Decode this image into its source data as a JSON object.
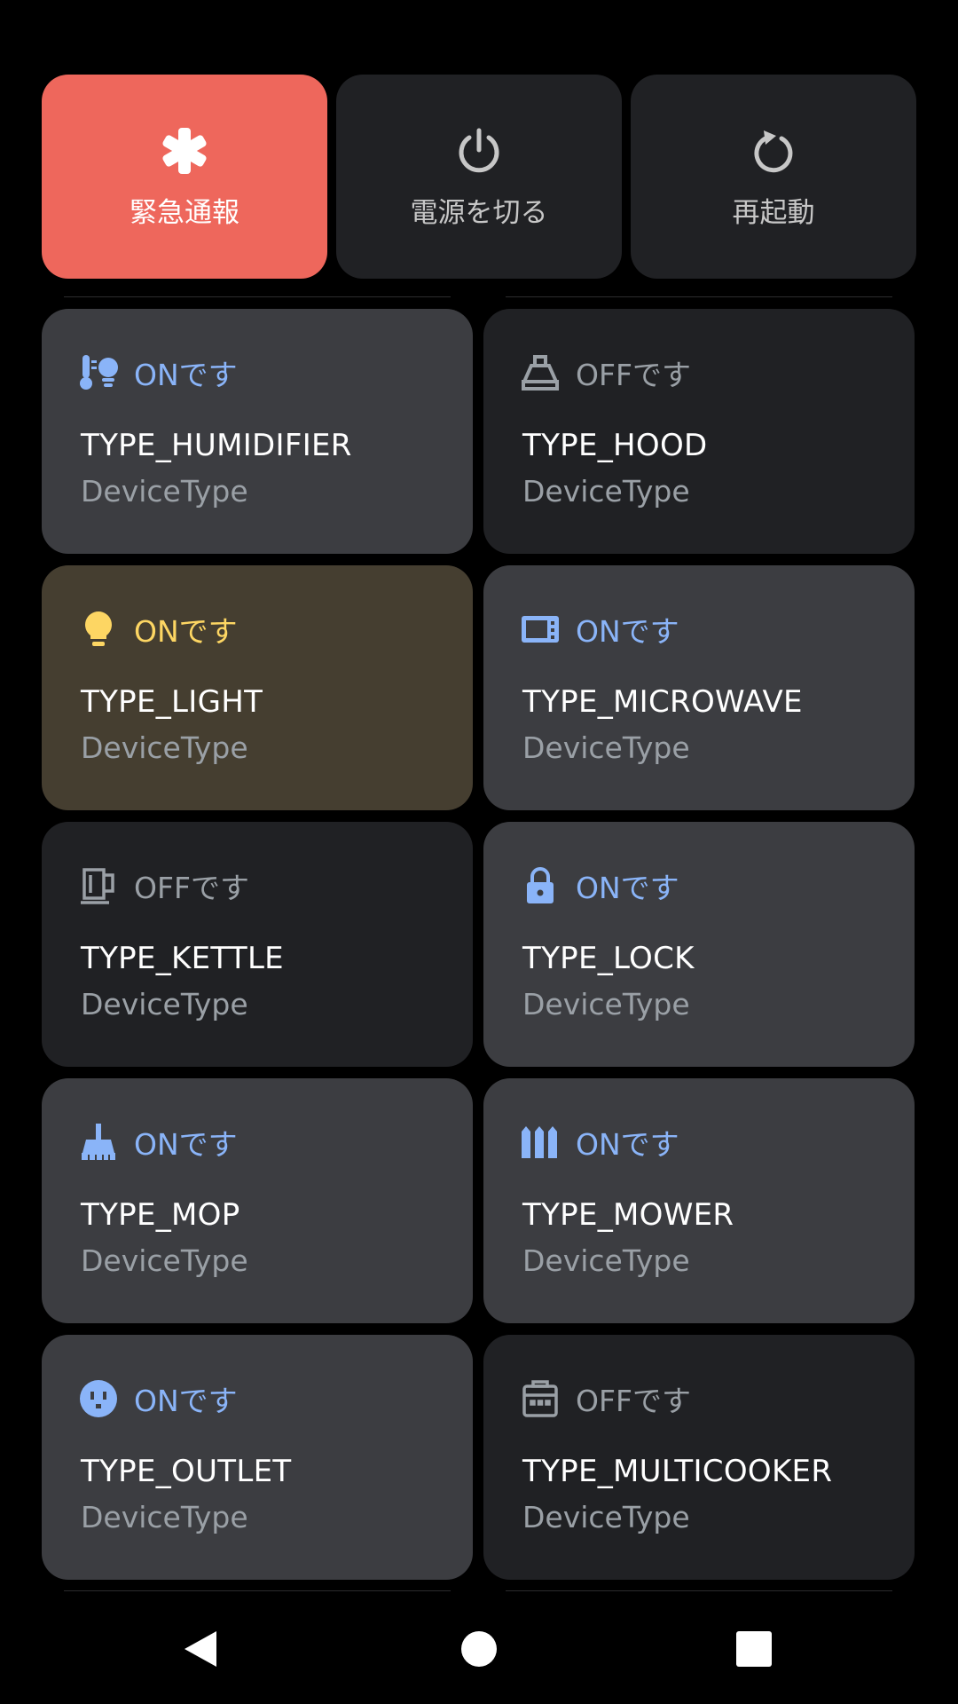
{
  "power_menu": {
    "emergency_label": "緊急通報",
    "power_off_label": "電源を切る",
    "restart_label": "再起動"
  },
  "tiles": [
    {
      "status": "ONです",
      "name": "TYPE_HUMIDIFIER",
      "subtitle": "DeviceType",
      "icon": "humidifier-icon"
    },
    {
      "status": "OFFです",
      "name": "TYPE_HOOD",
      "subtitle": "DeviceType",
      "icon": "hood-icon"
    },
    {
      "status": "ONです",
      "name": "TYPE_LIGHT",
      "subtitle": "DeviceType",
      "icon": "lightbulb-icon"
    },
    {
      "status": "ONです",
      "name": "TYPE_MICROWAVE",
      "subtitle": "DeviceType",
      "icon": "microwave-icon"
    },
    {
      "status": "OFFです",
      "name": "TYPE_KETTLE",
      "subtitle": "DeviceType",
      "icon": "kettle-icon"
    },
    {
      "status": "ONです",
      "name": "TYPE_LOCK",
      "subtitle": "DeviceType",
      "icon": "lock-icon"
    },
    {
      "status": "ONです",
      "name": "TYPE_MOP",
      "subtitle": "DeviceType",
      "icon": "mop-icon"
    },
    {
      "status": "ONです",
      "name": "TYPE_MOWER",
      "subtitle": "DeviceType",
      "icon": "mower-icon"
    },
    {
      "status": "ONです",
      "name": "TYPE_OUTLET",
      "subtitle": "DeviceType",
      "icon": "outlet-icon"
    },
    {
      "status": "OFFです",
      "name": "TYPE_MULTICOOKER",
      "subtitle": "DeviceType",
      "icon": "multicooker-icon"
    }
  ],
  "colors": {
    "emergency": "#ee675c",
    "tile_on": "#3c3d41",
    "tile_off": "#202124",
    "tile_light": "#453e30",
    "status_on": "#8ab4f8",
    "status_light": "#fdd663",
    "status_off": "#9aa0a6"
  },
  "nav": {
    "back_icon": "back-triangle-icon",
    "home_icon": "home-circle-icon",
    "recents_icon": "recents-square-icon"
  }
}
